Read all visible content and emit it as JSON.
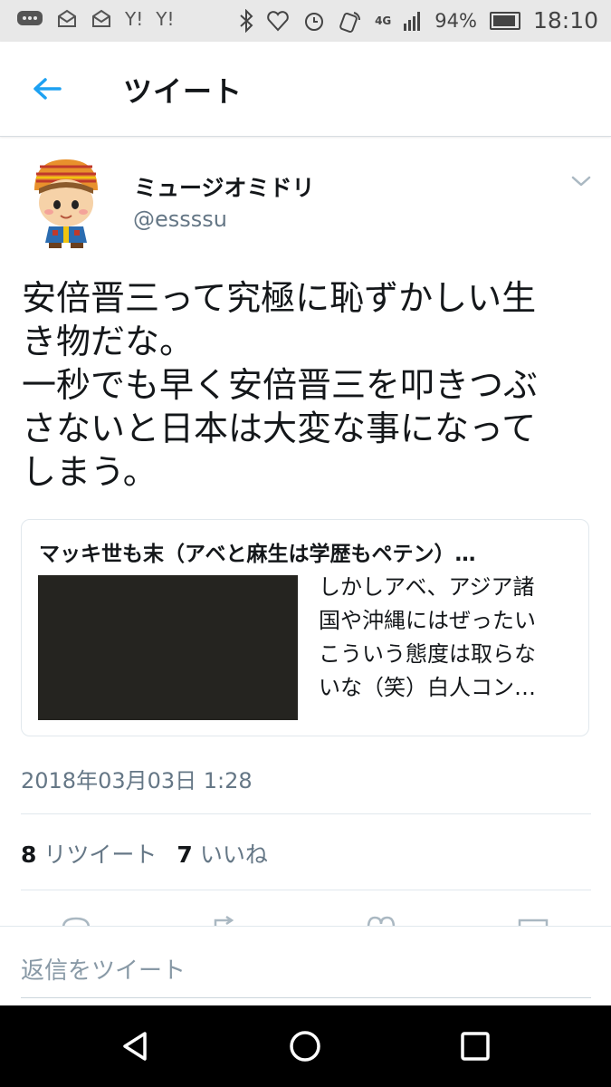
{
  "status_bar": {
    "battery_percent": "94%",
    "time": "18:10",
    "network": "4G",
    "notif_icons": [
      "Y!",
      "Y!"
    ]
  },
  "header": {
    "title": "ツイート"
  },
  "tweet": {
    "display_name": "ミュージオミドリ",
    "handle": "@essssu",
    "text": "安倍晋三って究極に恥ずかしい生\nき物だな。\n一秒でも早く安倍晋三を叩きつぶ\nさないと日本は大変な事になって\nしまう。",
    "timestamp": "2018年03月03日 1:28",
    "retweets_count": "8",
    "retweets_label": "リツイート",
    "likes_count": "7",
    "likes_label": "いいね"
  },
  "card": {
    "title": "マッキ世も末（アベと麻生は学歴もペテン）…",
    "desc_lines": [
      "しかしアベ、アジア諸",
      "国や沖縄にはぜったい",
      "こういう態度は取らな",
      "いな（笑）白人コン…"
    ]
  },
  "reply": {
    "placeholder": "返信をツイート"
  },
  "colors": {
    "accent": "#1da1f2",
    "secondary_text": "#657786",
    "divider": "#e1e8ed"
  }
}
